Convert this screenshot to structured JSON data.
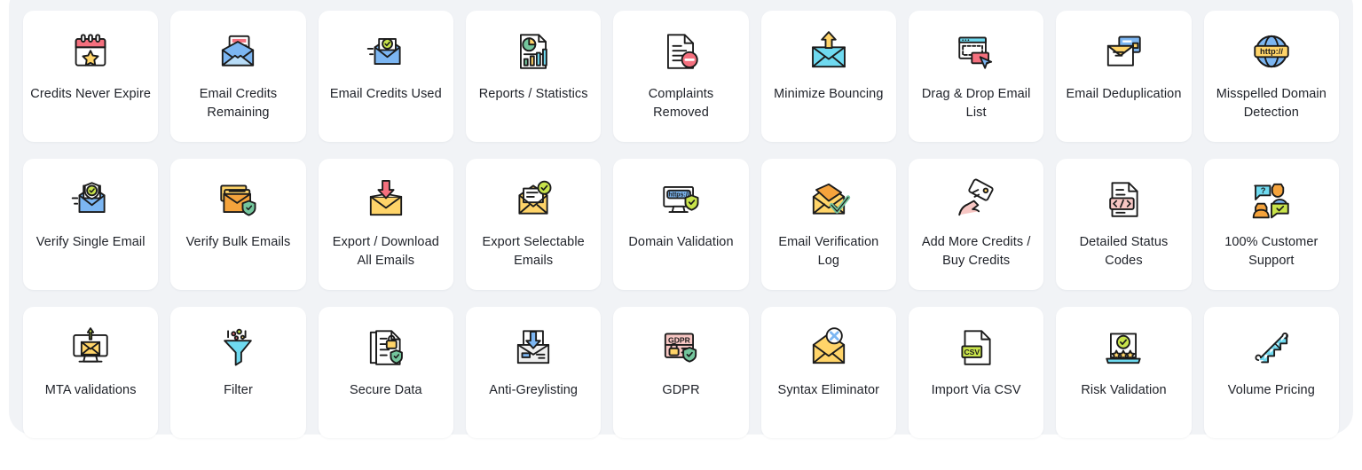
{
  "panel": {
    "background_color": "#f1f3f6",
    "card_background_color": "#ffffff",
    "label_color": "#20232a"
  },
  "features": [
    {
      "label": "Credits Never Expire",
      "icon": "calendar-star-icon"
    },
    {
      "label": "Email Credits Remaining",
      "icon": "open-envelope-letter-icon"
    },
    {
      "label": "Email Credits Used",
      "icon": "envelope-check-icon"
    },
    {
      "label": "Reports / Statistics",
      "icon": "report-chart-document-icon"
    },
    {
      "label": "Complaints Removed",
      "icon": "document-minus-icon"
    },
    {
      "label": "Minimize Bouncing",
      "icon": "envelope-up-arrow-icon"
    },
    {
      "label": "Drag & Drop Email List",
      "icon": "drag-drop-cursor-icon"
    },
    {
      "label": "Email Deduplication",
      "icon": "duplicate-envelopes-icon"
    },
    {
      "label": "Misspelled Domain Detection",
      "icon": "globe-http-icon"
    },
    {
      "label": "Verify Single Email",
      "icon": "envelope-shield-check-icon"
    },
    {
      "label": "Verify Bulk Emails",
      "icon": "stacked-envelopes-shield-icon"
    },
    {
      "label": "Export / Download All Emails",
      "icon": "envelope-download-arrow-icon"
    },
    {
      "label": "Export Selectable Emails",
      "icon": "envelope-badge-check-icon"
    },
    {
      "label": "Domain Validation",
      "icon": "monitor-https-shield-icon"
    },
    {
      "label": "Email Verification Log",
      "icon": "envelope-green-check-icon"
    },
    {
      "label": "Add More Credits / Buy Credits",
      "icon": "hand-credit-card-icon"
    },
    {
      "label": "Detailed Status Codes",
      "icon": "code-document-icon"
    },
    {
      "label": "100% Customer Support",
      "icon": "support-agents-chat-icon"
    },
    {
      "label": "MTA validations",
      "icon": "monitor-envelope-up-icon"
    },
    {
      "label": "Filter",
      "icon": "funnel-filter-icon"
    },
    {
      "label": "Secure Data",
      "icon": "document-lock-shield-icon"
    },
    {
      "label": "Anti-Greylisting",
      "icon": "envelope-down-arrow-icon"
    },
    {
      "label": "GDPR",
      "icon": "gdpr-lock-shield-icon"
    },
    {
      "label": "Syntax Eliminator",
      "icon": "envelope-x-badge-icon"
    },
    {
      "label": "Import Via CSV",
      "icon": "csv-file-icon"
    },
    {
      "label": "Risk Validation",
      "icon": "laptop-stars-check-icon"
    },
    {
      "label": "Volume Pricing",
      "icon": "escalator-growth-icon"
    }
  ],
  "icon_colors": {
    "outline": "#1b1b1b",
    "red": "#f4707e",
    "yellow": "#ffd469",
    "orange": "#f5a33c",
    "blue": "#7cb6f2",
    "cyan": "#6fdaf0",
    "green": "#74c69d",
    "lime": "#c8e34b",
    "pink": "#f7c6c3",
    "white": "#ffffff"
  }
}
